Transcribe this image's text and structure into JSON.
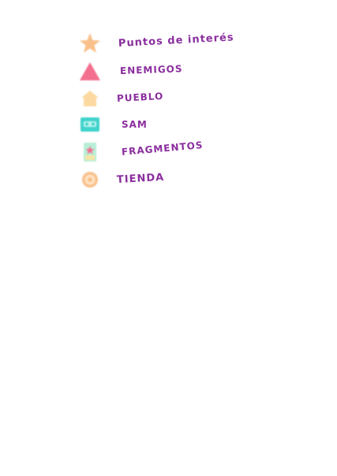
{
  "legend": {
    "items": [
      {
        "icon": "star-icon",
        "label": "Puntos de interés",
        "color": "#f9c08a"
      },
      {
        "icon": "triangle-icon",
        "label": "ENEMIGOS",
        "color": "#f36f8f"
      },
      {
        "icon": "house-icon",
        "label": "PUEBLO",
        "color": "#fbd9a1"
      },
      {
        "icon": "cassette-icon",
        "label": "SAM",
        "color": "#3fd3cb"
      },
      {
        "icon": "card-icon",
        "label": "FRAGMENTOS",
        "color": "#b9eed6"
      },
      {
        "icon": "coin-icon",
        "label": "TIENDA",
        "color": "#f9c08a"
      }
    ],
    "label_color": "#8b2f9e"
  }
}
